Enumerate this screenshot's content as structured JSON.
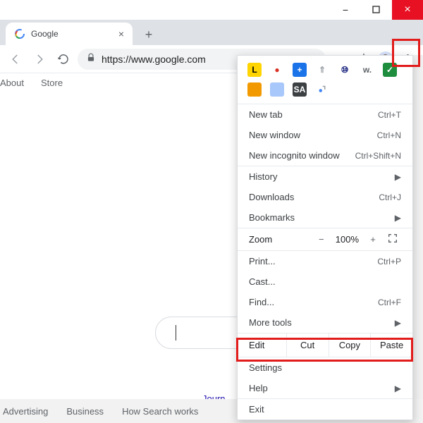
{
  "window": {
    "minimize": "−",
    "maximize": "□",
    "close": "×"
  },
  "tab": {
    "title": "Google",
    "close": "×"
  },
  "omnibar": {
    "url": "https://www.google.com"
  },
  "gnav": {
    "about": "About",
    "store": "Store"
  },
  "link": {
    "journeys": "Journ"
  },
  "footer": {
    "adv": "Advertising",
    "biz": "Business",
    "how": "How Search works"
  },
  "ext": {
    "r1": [
      "L",
      "●",
      "+",
      "⇑",
      "⑩",
      "w.",
      "✓"
    ],
    "r2": [
      "",
      "",
      "SA",
      ""
    ]
  },
  "menu": {
    "newtab": {
      "label": "New tab",
      "shortcut": "Ctrl+T"
    },
    "newwin": {
      "label": "New window",
      "shortcut": "Ctrl+N"
    },
    "incog": {
      "label": "New incognito window",
      "shortcut": "Ctrl+Shift+N"
    },
    "history": {
      "label": "History"
    },
    "downloads": {
      "label": "Downloads",
      "shortcut": "Ctrl+J"
    },
    "bookmarks": {
      "label": "Bookmarks"
    },
    "zoom": {
      "label": "Zoom",
      "minus": "−",
      "value": "100%",
      "plus": "+"
    },
    "print": {
      "label": "Print...",
      "shortcut": "Ctrl+P"
    },
    "cast": {
      "label": "Cast..."
    },
    "find": {
      "label": "Find...",
      "shortcut": "Ctrl+F"
    },
    "more": {
      "label": "More tools"
    },
    "edit": {
      "label": "Edit",
      "cut": "Cut",
      "copy": "Copy",
      "paste": "Paste"
    },
    "settings": {
      "label": "Settings"
    },
    "help": {
      "label": "Help"
    },
    "exit": {
      "label": "Exit"
    }
  }
}
